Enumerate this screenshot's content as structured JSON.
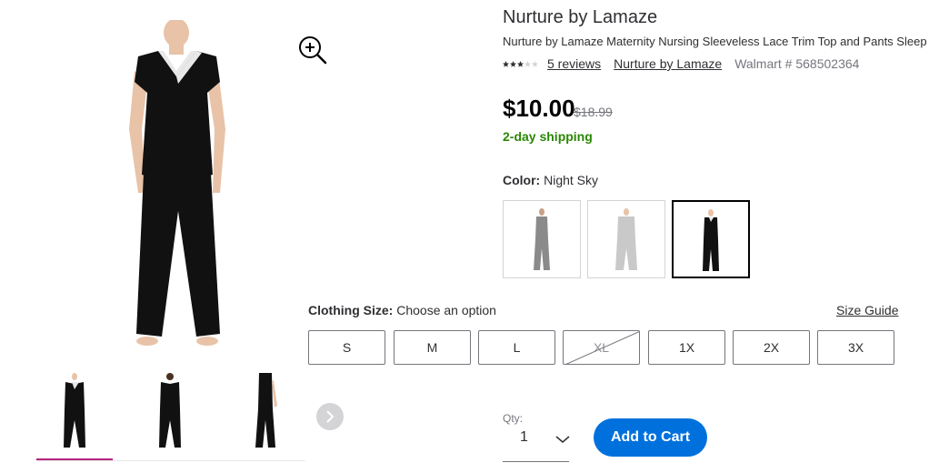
{
  "product": {
    "brand_title": "Nurture by Lamaze",
    "name": "Nurture by Lamaze Maternity Nursing Sleeveless Lace Trim Top and Pants Sleep",
    "rating_stars": 3,
    "reviews_link": "5 reviews",
    "brand_link": "Nurture by Lamaze",
    "walmart_number": "Walmart # 568502364",
    "price": "$10.00",
    "was_price": "$18.99",
    "shipping": "2-day shipping"
  },
  "color": {
    "label": "Color:",
    "selected": "Night Sky",
    "swatches": [
      {
        "name": "gray",
        "color": "#8a8a8a"
      },
      {
        "name": "light-gray",
        "color": "#c9c9c9"
      },
      {
        "name": "night-sky",
        "color": "#111111"
      }
    ]
  },
  "size": {
    "label": "Clothing Size:",
    "value": "Choose an option",
    "guide_link": "Size Guide",
    "options": [
      "S",
      "M",
      "L",
      "XL",
      "1X",
      "2X",
      "3X"
    ],
    "unavailable": [
      "XL"
    ]
  },
  "quantity": {
    "label": "Qty:",
    "value": "1"
  },
  "cart": {
    "add_label": "Add to Cart"
  },
  "colors": {
    "accent": "#0071dc",
    "shipping": "#2a8703",
    "thumb_active": "#b6247f",
    "garment": "#111111",
    "lace": "#e8e8e8",
    "skin": "#e8c3a8"
  },
  "icons": {
    "zoom": "zoom-in-icon",
    "next": "chevron-right-icon",
    "qty": "chevron-down-icon"
  }
}
